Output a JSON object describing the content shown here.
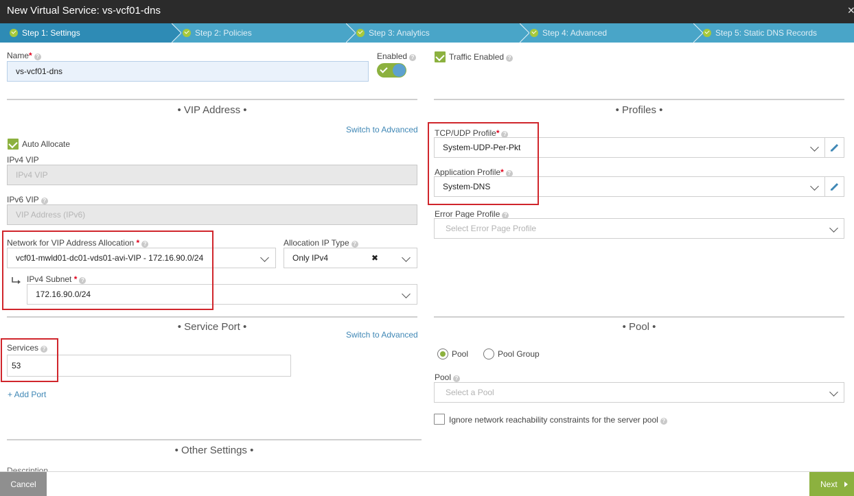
{
  "window": {
    "title": "New Virtual Service: vs-vcf01-dns",
    "close_icon": "close-icon"
  },
  "steps": [
    {
      "label": "Step 1: Settings",
      "active": true
    },
    {
      "label": "Step 2: Policies",
      "active": false
    },
    {
      "label": "Step 3: Analytics",
      "active": false
    },
    {
      "label": "Step 4: Advanced",
      "active": false
    },
    {
      "label": "Step 5: Static DNS Records",
      "active": false
    }
  ],
  "general": {
    "name_label": "Name",
    "name_value": "vs-vcf01-dns",
    "enabled_label": "Enabled",
    "enabled": true,
    "traffic_enabled_label": "Traffic Enabled",
    "traffic_enabled": true
  },
  "vip": {
    "section_title": "• VIP Address •",
    "switch_link": "Switch to Advanced",
    "auto_allocate_label": "Auto Allocate",
    "auto_allocate": true,
    "ipv4_label": "IPv4 VIP",
    "ipv4_placeholder": "IPv4 VIP",
    "ipv6_label": "IPv6 VIP",
    "ipv6_placeholder": "VIP Address (IPv6)",
    "network_label": "Network for VIP Address Allocation",
    "network_value": "vcf01-mwld01-dc01-vds01-avi-VIP - 172.16.90.0/24",
    "alloc_type_label": "Allocation IP Type",
    "alloc_type_value": "Only IPv4",
    "subnet_label": "IPv4 Subnet",
    "subnet_value": "172.16.90.0/24"
  },
  "profiles": {
    "section_title": "• Profiles •",
    "tcpudp_label": "TCP/UDP Profile",
    "tcpudp_value": "System-UDP-Per-Pkt",
    "app_label": "Application Profile",
    "app_value": "System-DNS",
    "error_label": "Error Page Profile",
    "error_placeholder": "Select Error Page Profile"
  },
  "service_port": {
    "section_title": "• Service Port •",
    "switch_link": "Switch to Advanced",
    "services_label": "Services",
    "services_value": "53",
    "add_port": "+ Add Port"
  },
  "pool": {
    "section_title": "• Pool •",
    "radio_pool": "Pool",
    "radio_pool_group": "Pool Group",
    "selected": "Pool",
    "pool_label": "Pool",
    "pool_placeholder": "Select a Pool",
    "ignore_label": "Ignore network reachability constraints for the server pool",
    "ignore_checked": false
  },
  "other": {
    "section_title": "• Other Settings •",
    "description_label": "Description"
  },
  "footer": {
    "cancel": "Cancel",
    "next": "Next"
  },
  "colors": {
    "accent_green": "#8cb13f",
    "step_bar": "#49a5c8",
    "step_active": "#2e8bb5",
    "highlight_red": "#d0252b",
    "link_blue": "#3f87b5"
  }
}
